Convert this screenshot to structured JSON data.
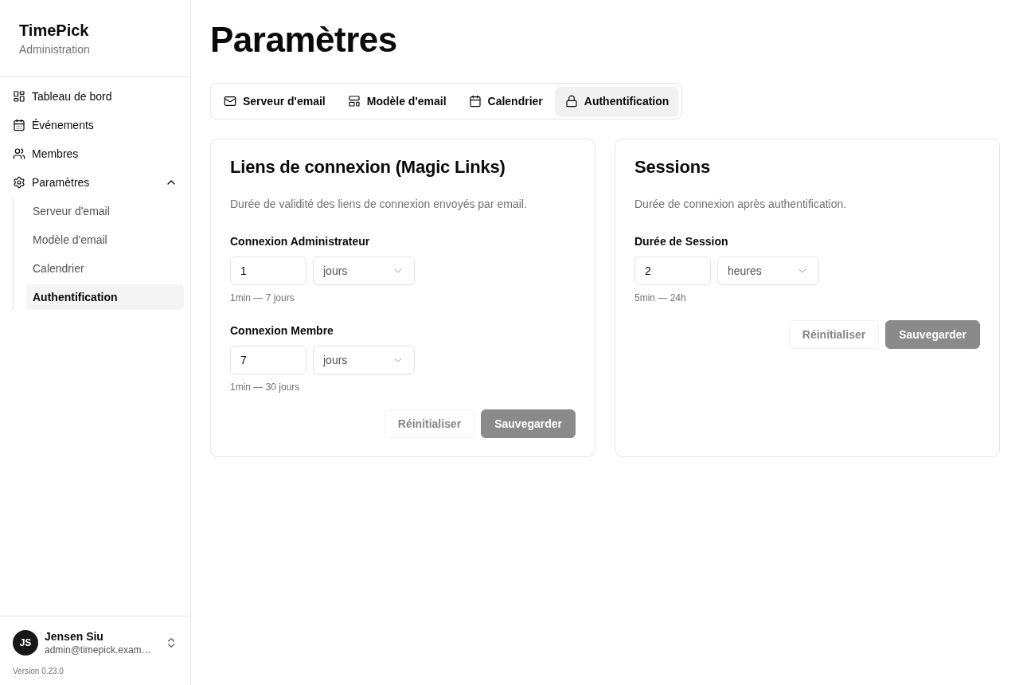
{
  "sidebar": {
    "brand": {
      "title": "TimePick",
      "subtitle": "Administration"
    },
    "nav": [
      {
        "label": "Tableau de bord",
        "selected": false
      },
      {
        "label": "Événements",
        "selected": false
      },
      {
        "label": "Membres",
        "selected": false
      },
      {
        "label": "Paramètres",
        "selected": false,
        "expanded": true,
        "children": [
          {
            "label": "Serveur d'email",
            "selected": false
          },
          {
            "label": "Modèle d'email",
            "selected": false
          },
          {
            "label": "Calendrier",
            "selected": false
          },
          {
            "label": "Authentification",
            "selected": true
          }
        ]
      }
    ],
    "user": {
      "initials": "JS",
      "name": "Jensen Siu",
      "email": "admin@timepick.exam…"
    },
    "version": "Version 0.23.0"
  },
  "page": {
    "title": "Paramètres"
  },
  "tabs": [
    {
      "label": "Serveur d'email",
      "selected": false
    },
    {
      "label": "Modèle d'email",
      "selected": false
    },
    {
      "label": "Calendrier",
      "selected": false
    },
    {
      "label": "Authentification",
      "selected": true
    }
  ],
  "cards": [
    {
      "title": "Liens de connexion (Magic Links)",
      "description": "Durée de validité des liens de connexion envoyés par email.",
      "fields": [
        {
          "label": "Connexion Administrateur",
          "value": "1",
          "unit": "jours",
          "hint": "1min — 7 jours"
        },
        {
          "label": "Connexion Membre",
          "value": "7",
          "unit": "jours",
          "hint": "1min — 30 jours"
        }
      ],
      "buttons": [
        {
          "label": "Réinitialiser",
          "kind": "outline",
          "disabled": true
        },
        {
          "label": "Sauvegarder",
          "kind": "primary",
          "disabled": true
        }
      ]
    },
    {
      "title": "Sessions",
      "description": "Durée de connexion après authentification.",
      "fields": [
        {
          "label": "Durée de Session",
          "value": "2",
          "unit": "heures",
          "hint": "5min — 24h"
        }
      ],
      "buttons": [
        {
          "label": "Réinitialiser",
          "kind": "outline",
          "disabled": true
        },
        {
          "label": "Sauvegarder",
          "kind": "primary",
          "disabled": true
        }
      ]
    }
  ]
}
